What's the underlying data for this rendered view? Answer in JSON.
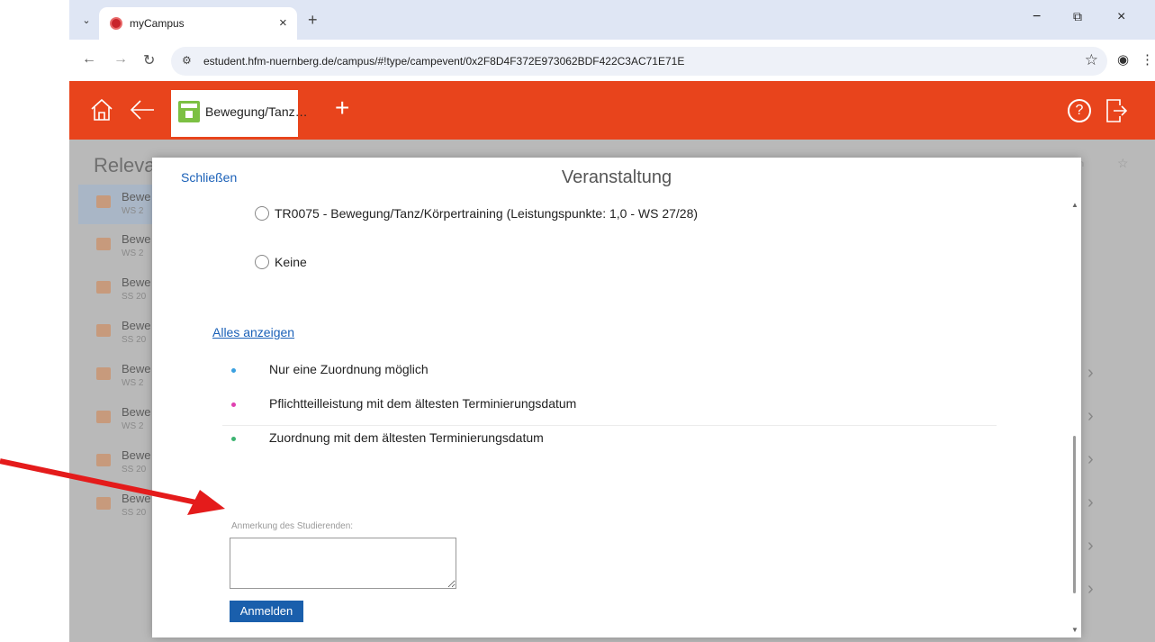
{
  "browser": {
    "tab_title": "myCampus",
    "tab_close": "×",
    "new_tab": "+",
    "url": "estudent.hfm-nuernberg.de/campus/#!type/campevent/0x2F8D4F372E973062BDF422C3AC71E71E",
    "controls": {
      "minimize": "−",
      "restore": "⧉",
      "close": "×"
    }
  },
  "app": {
    "tab_label": "Bewegung/Tanz…",
    "help": "?"
  },
  "background": {
    "heading": "Releva",
    "rows": [
      {
        "title": "Bewe",
        "sub": "WS 2"
      },
      {
        "title": "Bewe",
        "sub": "WS 2"
      },
      {
        "title": "Bewe",
        "sub": "SS 20"
      },
      {
        "title": "Bewe",
        "sub": "SS 20"
      },
      {
        "title": "Bewe",
        "sub": "WS 2"
      },
      {
        "title": "Bewe",
        "sub": "WS 2"
      },
      {
        "title": "Bewe",
        "sub": "SS 20"
      },
      {
        "title": "Bewe",
        "sub": "SS 20"
      }
    ],
    "chevron": "›",
    "right_text": "en"
  },
  "modal": {
    "close": "Schließen",
    "title": "Veranstaltung",
    "options": [
      {
        "label": "TR0075 - Bewegung/Tanz/Körpertraining (Leistungspunkte: 1,0 - WS 27/28)"
      },
      {
        "label": "Keine"
      }
    ],
    "show_all": "Alles anzeigen",
    "legend": [
      {
        "text": "Nur eine Zuordnung möglich",
        "color": "#3aa0e0"
      },
      {
        "text": "Pflichtteilleistung mit dem ältesten Terminierungsdatum",
        "color": "#e040b0"
      },
      {
        "text": "Zuordnung mit dem ältesten Terminierungsdatum",
        "color": "#3cb371"
      }
    ],
    "note_label": "Anmerkung des Studierenden:",
    "note_value": "",
    "submit": "Anmelden"
  }
}
